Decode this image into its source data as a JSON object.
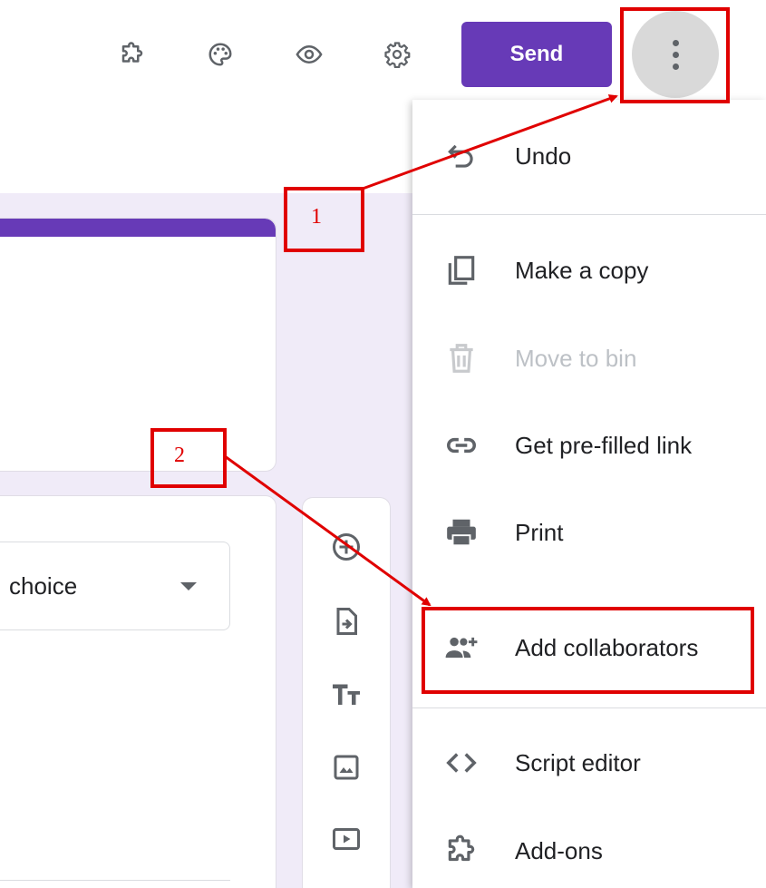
{
  "topbar": {
    "icons": [
      "addon-puzzle-icon",
      "palette-icon",
      "preview-eye-icon",
      "settings-gear-icon"
    ],
    "send_label": "Send",
    "more_icon": "more-vert-icon"
  },
  "form": {
    "question_type": "choice"
  },
  "floating_toolbar": {
    "icons": [
      "add-question-icon",
      "import-questions-icon",
      "add-title-icon",
      "add-image-icon",
      "add-video-icon"
    ]
  },
  "menu": {
    "items": [
      {
        "label": "Undo",
        "icon": "undo-icon",
        "enabled": true
      },
      {
        "label": "Make a copy",
        "icon": "copy-icon",
        "enabled": true
      },
      {
        "label": "Move to bin",
        "icon": "trash-icon",
        "enabled": false
      },
      {
        "label": "Get pre-filled link",
        "icon": "link-icon",
        "enabled": true
      },
      {
        "label": "Print",
        "icon": "print-icon",
        "enabled": true
      },
      {
        "label": "Add collaborators",
        "icon": "add-people-icon",
        "enabled": true
      },
      {
        "label": "Script editor",
        "icon": "code-icon",
        "enabled": true
      },
      {
        "label": "Add-ons",
        "icon": "addon-puzzle-icon",
        "enabled": true
      }
    ]
  },
  "annotations": {
    "step1": "1",
    "step2": "2",
    "color": "#e00000"
  },
  "colors": {
    "accent": "#673ab7",
    "canvas": "#f0ebf8"
  }
}
